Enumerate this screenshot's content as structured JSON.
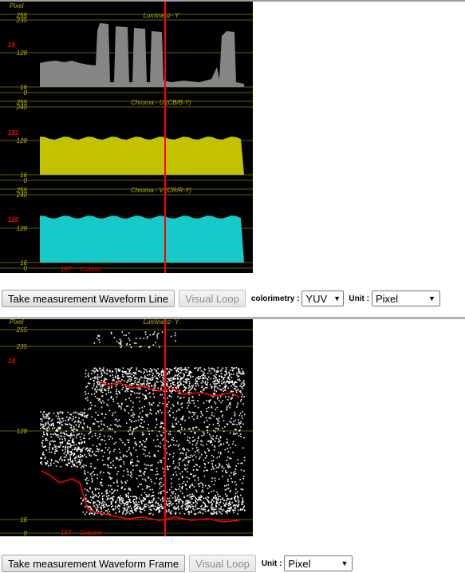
{
  "scope1": {
    "panels": [
      {
        "title": "Luminanz- Y",
        "fill": "#858585",
        "ticks": [
          "255",
          "235",
          "128",
          "16",
          "0"
        ],
        "value": "19"
      },
      {
        "title": "Chroma - U (CB/B-Y)",
        "fill": "#c2c200",
        "ticks": [
          "255",
          "240",
          "128",
          "16",
          "0"
        ],
        "value": "151"
      },
      {
        "title": "Chroma - V (CR/R-Y)",
        "fill": "#17c9c9",
        "ticks": [
          "255",
          "240",
          "128",
          "16",
          "0"
        ],
        "value": "120"
      }
    ],
    "pixel_label": "Pixel",
    "column_value": "157",
    "column_label": "Column"
  },
  "controls1": {
    "measure_button": "Take measurement Waveform Line",
    "loop_button": "Visual Loop",
    "colorimetry_label": "colorimetry :",
    "colorimetry_value": "YUV",
    "unit_label": "Unit :",
    "unit_value": "Pixel"
  },
  "scope2": {
    "title": "Luminanz- Y",
    "pixel_label": "Pixel",
    "ticks": [
      "255",
      "235",
      "128",
      "16",
      "0"
    ],
    "value": "19",
    "column_value": "157",
    "column_label": "Column"
  },
  "controls2": {
    "measure_button": "Take measurement Waveform Frame",
    "loop_button": "Visual Loop",
    "unit_label": "Unit :",
    "unit_value": "Pixel"
  },
  "colors": {
    "grid": "#5f5f00",
    "label": "#b9b900",
    "marker": "#ff0000",
    "luma": "#858585",
    "chroma_u": "#c2c200",
    "chroma_v": "#17c9c9"
  }
}
